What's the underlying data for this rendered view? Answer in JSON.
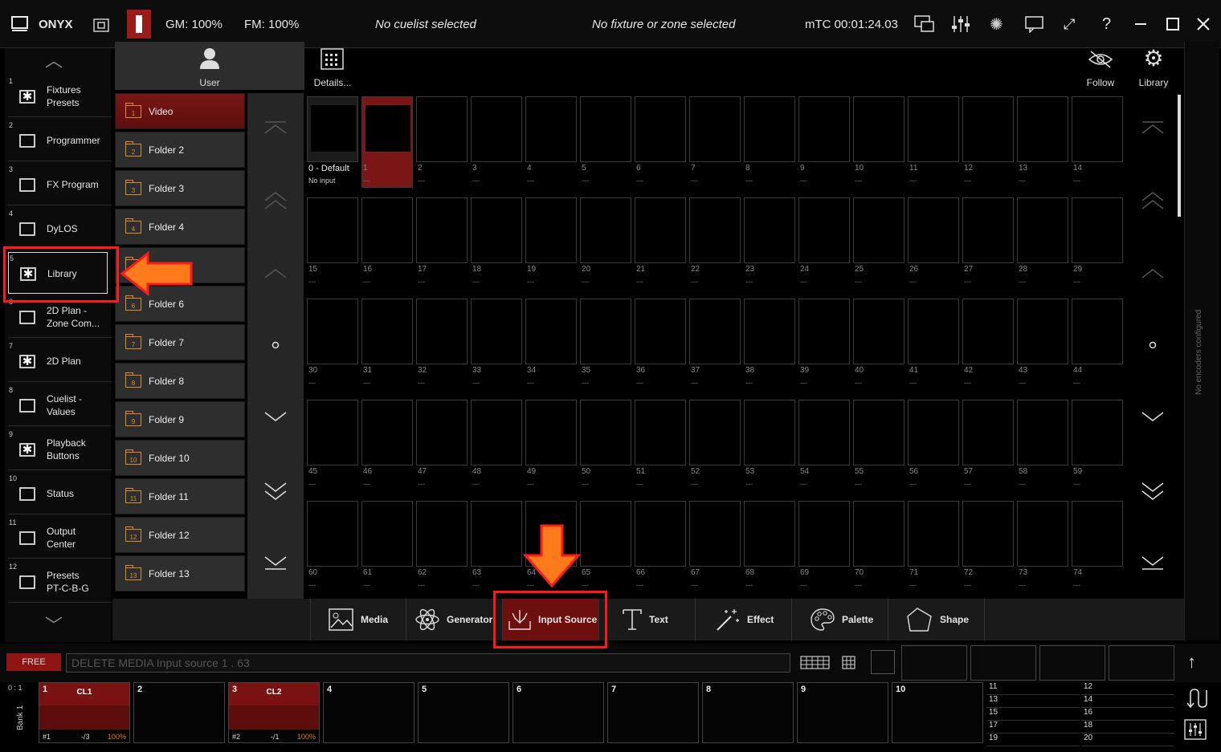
{
  "app": {
    "name": "ONYX",
    "gm": "GM: 100%",
    "fm": "FM: 100%",
    "cuelist_status": "No cuelist selected",
    "fixture_status": "No fixture or zone selected",
    "timecode": "mTC 00:01:24.03"
  },
  "sidebar": {
    "items": [
      {
        "num": "1",
        "label": "Fixtures\nPresets",
        "star": true
      },
      {
        "num": "2",
        "label": "Programmer",
        "star": false
      },
      {
        "num": "3",
        "label": "FX Program",
        "star": false
      },
      {
        "num": "4",
        "label": "DyLOS",
        "star": false
      },
      {
        "num": "5",
        "label": "Library",
        "star": true
      },
      {
        "num": "6",
        "label": "2D Plan -\nZone Com...",
        "star": false
      },
      {
        "num": "7",
        "label": "2D Plan",
        "star": true
      },
      {
        "num": "8",
        "label": "Cuelist -\nValues",
        "star": false
      },
      {
        "num": "9",
        "label": "Playback\nButtons",
        "star": true
      },
      {
        "num": "10",
        "label": "Status",
        "star": false
      },
      {
        "num": "11",
        "label": "Output\nCenter",
        "star": false
      },
      {
        "num": "12",
        "label": "Presets\nPT-C-B-G",
        "star": false
      }
    ]
  },
  "header_buttons": {
    "user": "User",
    "details": "Details...",
    "follow": "Follow",
    "library": "Library"
  },
  "folders": [
    {
      "num": "1",
      "label": "Video"
    },
    {
      "num": "2",
      "label": "Folder 2"
    },
    {
      "num": "3",
      "label": "Folder 3"
    },
    {
      "num": "4",
      "label": "Folder 4"
    },
    {
      "num": "5",
      "label": ""
    },
    {
      "num": "6",
      "label": "Folder 6"
    },
    {
      "num": "7",
      "label": "Folder 7"
    },
    {
      "num": "8",
      "label": "Folder 8"
    },
    {
      "num": "9",
      "label": "Folder 9"
    },
    {
      "num": "10",
      "label": "Folder 10"
    },
    {
      "num": "11",
      "label": "Folder 11"
    },
    {
      "num": "12",
      "label": "Folder 12"
    },
    {
      "num": "13",
      "label": "Folder 13"
    }
  ],
  "grid": {
    "first_label": "0 - Default",
    "first_sub": "No input",
    "empty_sub": "---"
  },
  "encoders_text": "No encoders configured",
  "toolbar": {
    "media": "Media",
    "generator": "Generator",
    "input_source": "Input Source",
    "text": "Text",
    "effect": "Effect",
    "palette": "Palette",
    "shape": "Shape"
  },
  "command": {
    "mode": "FREE",
    "line": "DELETE MEDIA Input source 1 . 63"
  },
  "playbacks": {
    "bank_top": "0 : 1",
    "bank_label": "Bank 1",
    "slots": [
      {
        "num": "1",
        "name": "CL1",
        "cue": "#1",
        "step": "-/3",
        "level": "100%"
      },
      {
        "num": "2"
      },
      {
        "num": "3",
        "name": "CL2",
        "cue": "#2",
        "step": "-/1",
        "level": "100%"
      },
      {
        "num": "4"
      },
      {
        "num": "5"
      },
      {
        "num": "6"
      },
      {
        "num": "7"
      },
      {
        "num": "8"
      },
      {
        "num": "9"
      },
      {
        "num": "10"
      }
    ],
    "mini_left": [
      "11",
      "13",
      "15",
      "17",
      "19"
    ],
    "mini_right": [
      "12",
      "14",
      "16",
      "18",
      "20"
    ]
  },
  "colors": {
    "accent": "#9b1b1b",
    "highlight": "#ff1a1a",
    "arrow": "#ff7a1a"
  }
}
